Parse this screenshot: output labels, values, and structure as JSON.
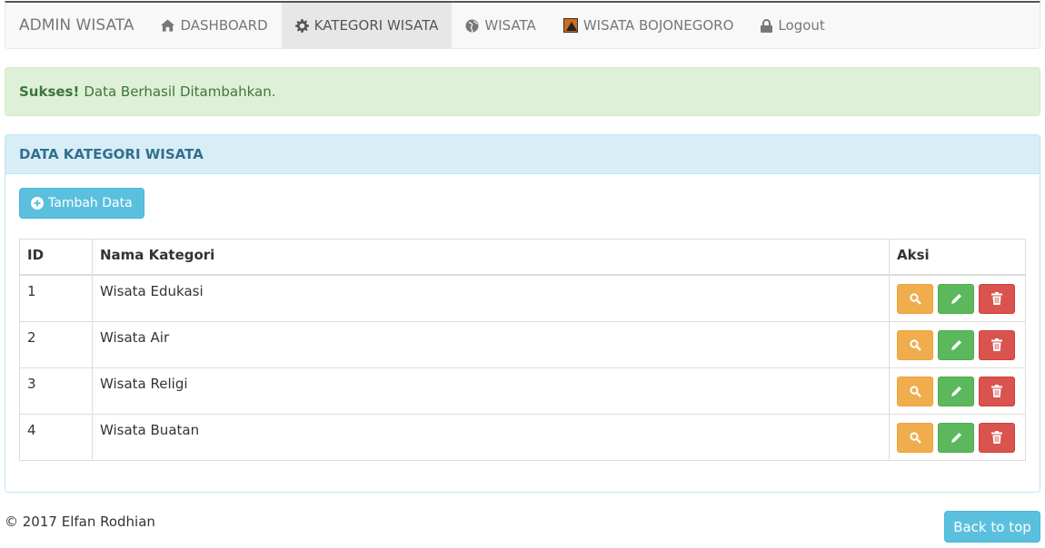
{
  "navbar": {
    "brand": "ADMIN WISATA",
    "items": [
      {
        "label": "DASHBOARD",
        "icon": "home-icon",
        "active": false
      },
      {
        "label": "KATEGORI WISATA",
        "icon": "gear-icon",
        "active": true
      },
      {
        "label": "WISATA",
        "icon": "globe-icon",
        "active": false
      },
      {
        "label": "WISATA BOJONEGORO",
        "icon": "flag-icon",
        "active": false
      },
      {
        "label": "Logout",
        "icon": "lock-icon",
        "active": false
      }
    ]
  },
  "alert": {
    "strong": "Sukses!",
    "message": "Data Berhasil Ditambahkan."
  },
  "panel": {
    "title": "DATA KATEGORI WISATA",
    "add_button": "Tambah Data"
  },
  "table": {
    "headers": [
      "ID",
      "Nama Kategori",
      "Aksi"
    ],
    "rows": [
      {
        "id": "1",
        "name": "Wisata Edukasi"
      },
      {
        "id": "2",
        "name": "Wisata Air"
      },
      {
        "id": "3",
        "name": "Wisata Religi"
      },
      {
        "id": "4",
        "name": "Wisata Buatan"
      }
    ]
  },
  "footer": {
    "copyright": "© 2017 Elfan Rodhian",
    "back_to_top": "Back to top"
  },
  "colors": {
    "info": "#5bc0de",
    "success_bg": "#dff0d8",
    "warning": "#f0ad4e",
    "success": "#5cb85c",
    "danger": "#d9534f"
  }
}
